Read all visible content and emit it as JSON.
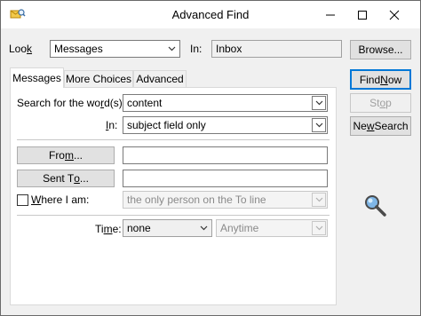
{
  "window": {
    "title": "Advanced Find",
    "app_icon": "find-window-icon",
    "controls": {
      "minimize_icon": "minimize-icon",
      "maximize_icon": "maximize-icon",
      "close_icon": "close-icon"
    }
  },
  "look": {
    "label_prefix": "Loo",
    "label_accel": "k",
    "value": "Messages",
    "in_label": "In:",
    "in_value": "Inbox",
    "browse_label": "Browse..."
  },
  "tabs": [
    {
      "label": "Messages",
      "active": true
    },
    {
      "label": "More Choices",
      "active": false
    },
    {
      "label": "Advanced",
      "active": false
    }
  ],
  "actions": {
    "find_now_prefix": "Find ",
    "find_now_accel": "N",
    "find_now_suffix": "ow",
    "stop_prefix": "St",
    "stop_accel": "o",
    "stop_suffix": "p",
    "new_search_prefix": "Ne",
    "new_search_accel": "w",
    "new_search_suffix": " Search"
  },
  "search": {
    "words_label_prefix": "Search for the wo",
    "words_label_accel": "r",
    "words_label_suffix": "d(s):",
    "words_value": "content",
    "in_label_accel": "I",
    "in_label_suffix": "n:",
    "in_value": "subject field only"
  },
  "people": {
    "from_label_prefix": "Fro",
    "from_label_accel": "m",
    "from_label_suffix": "...",
    "from_value": "",
    "sent_to_label_prefix": "Sent T",
    "sent_to_label_accel": "o",
    "sent_to_label_suffix": "...",
    "sent_to_value": "",
    "where_label_accel": "W",
    "where_label_suffix": "here I am:",
    "where_checked": false,
    "where_value": "the only person on the To line"
  },
  "time": {
    "label_prefix": "Ti",
    "label_accel": "m",
    "label_suffix": "e:",
    "value": "none",
    "range_value": "Anytime"
  },
  "search_graphic": "magnifier-icon",
  "colors": {
    "default_button_border": "#0078d7",
    "window_bg": "#f0f0f0",
    "magnifier_lens": "#7fb6e6"
  }
}
